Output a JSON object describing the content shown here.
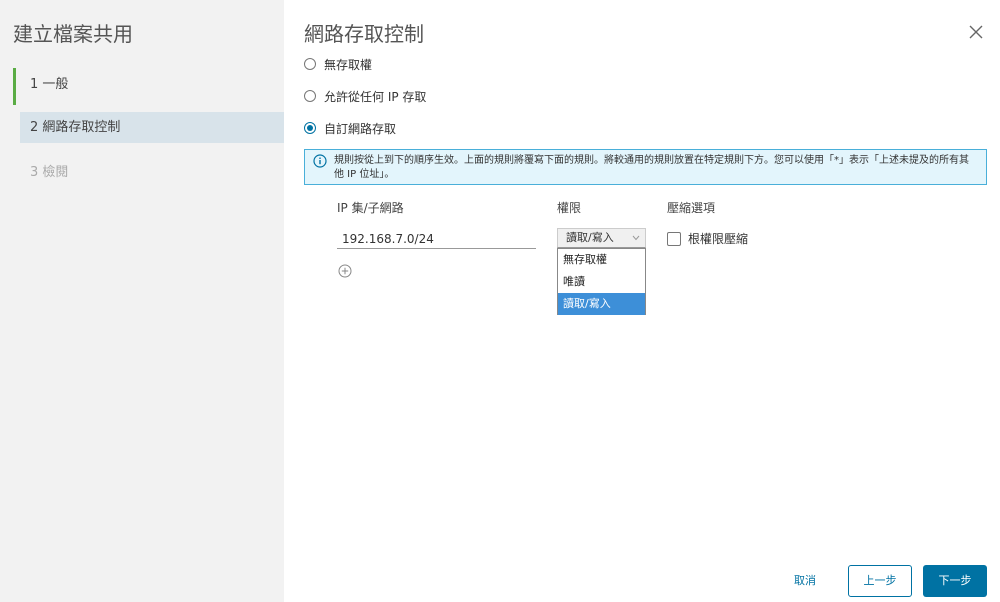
{
  "sidebar": {
    "title": "建立檔案共用",
    "steps": [
      {
        "label": "1 一般"
      },
      {
        "label": "2 網路存取控制"
      },
      {
        "label": "3 檢閱"
      }
    ]
  },
  "main": {
    "title": "網路存取控制",
    "options": [
      {
        "label": "無存取權",
        "checked": false
      },
      {
        "label": "允許從任何 IP 存取",
        "checked": false
      },
      {
        "label": "自訂網路存取",
        "checked": true
      }
    ],
    "info": "規則按從上到下的順序生效。上面的規則將覆寫下面的規則。將較通用的規則放置在特定規則下方。您可以使用「*」表示「上述未提及的所有其他 IP 位址」。",
    "columns": {
      "ip": "IP 集/子網路",
      "permission": "權限",
      "squash": "壓縮選項"
    },
    "rule": {
      "ip_value": "192.168.7.0/24",
      "permission_selected": "讀取/寫入",
      "permission_options": [
        "無存取權",
        "唯讀",
        "讀取/寫入"
      ],
      "squash_label": "根權限壓縮"
    }
  },
  "footer": {
    "cancel": "取消",
    "back": "上一步",
    "next": "下一步"
  },
  "colors": {
    "accent": "#0072a3",
    "active_step": "#5aac44",
    "info_bg": "#e3f5fc",
    "selected_option": "#3d8fd8"
  }
}
